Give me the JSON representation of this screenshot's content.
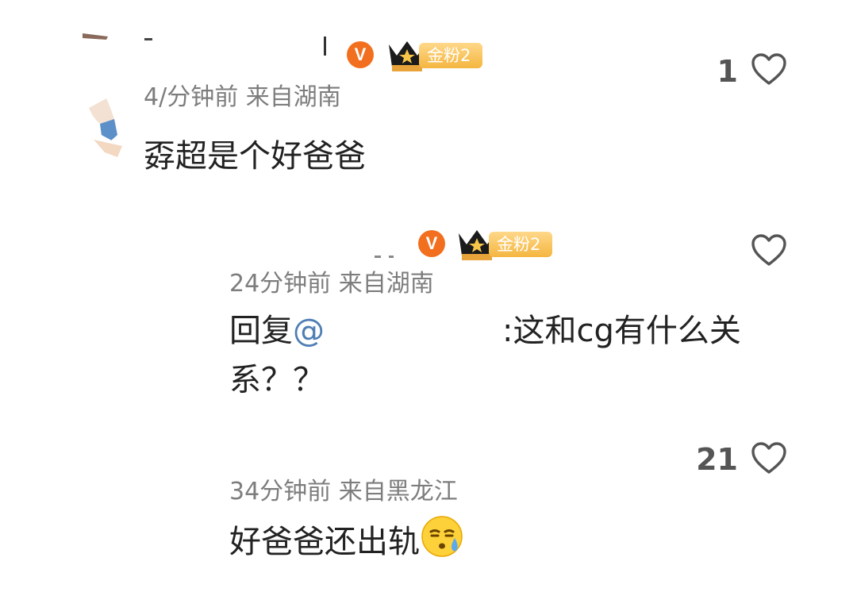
{
  "comments": [
    {
      "time": "4/分钟前 来自湖南",
      "text": "孬超是个好爸爸",
      "likes": "1",
      "fan_badge": "金粉2"
    },
    {
      "time": "24分钟前 来自湖南",
      "reply_prefix": "回复",
      "mention_symbol": "@",
      "text_line1": ":这和cg有什么关",
      "text_line2": "系？？",
      "likes": "",
      "fan_badge": "金粉2"
    },
    {
      "time": "34分钟前 来自黑龙江",
      "text": "好爸爸还出轨",
      "likes": "21"
    }
  ],
  "icons": {
    "verified": "V",
    "like": "heart-outline-icon",
    "crown": "crown-icon",
    "emoji": "sweat-face-emoji"
  },
  "colors": {
    "verified_badge": "#f26f1f",
    "fan_badge": "#f4b63f",
    "mention": "#4e7eb4",
    "meta": "#7d7d7d"
  }
}
